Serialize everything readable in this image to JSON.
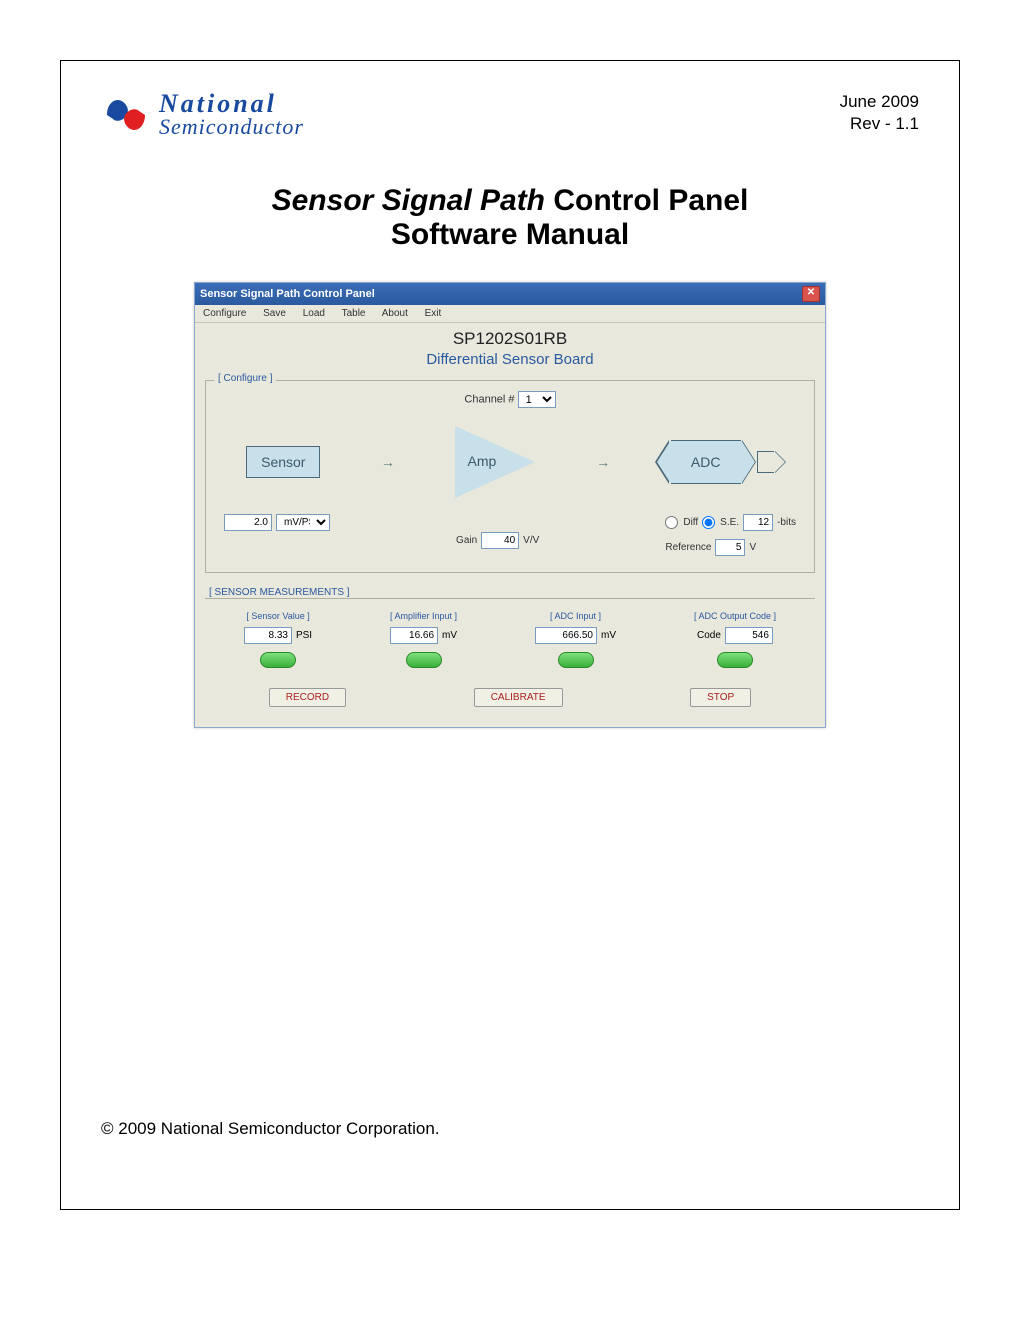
{
  "header": {
    "logo_main": "National",
    "logo_sub": "Semiconductor",
    "date": "June 2009",
    "rev": "Rev -  1.1"
  },
  "title": {
    "italic": "Sensor Signal Path",
    "bold1": " Control Panel",
    "line2": "Software Manual"
  },
  "app": {
    "title": "Sensor Signal Path Control Panel",
    "menu": [
      "Configure",
      "Save",
      "Load",
      "Table",
      "About",
      "Exit"
    ],
    "board_id": "SP1202S01RB",
    "board_desc": "Differential Sensor Board",
    "configure_label": "[ Configure ]",
    "channel_label": "Channel #",
    "channel_value": "1",
    "block_sensor": "Sensor",
    "block_amp": "Amp",
    "block_adc": "ADC",
    "sensor_value": "2.0",
    "sensor_unit": "mV/PSI",
    "gain_label": "Gain",
    "gain_value": "40",
    "gain_unit": "V/V",
    "diff_label": "Diff",
    "se_label": "S.E.",
    "bits_value": "12",
    "bits_unit": "-bits",
    "ref_label": "Reference",
    "ref_value": "5",
    "ref_unit": "V",
    "meas_title": "[ SENSOR MEASUREMENTS ]",
    "meas": {
      "c1": {
        "label": "[ Sensor Value ]",
        "value": "8.33",
        "unit": "PSI"
      },
      "c2": {
        "label": "[ Amplifier Input ]",
        "value": "16.66",
        "unit": "mV"
      },
      "c3": {
        "label": "[ ADC Input ]",
        "value": "666.50",
        "unit": "mV"
      },
      "c4": {
        "label": "[ ADC Output Code ]",
        "value": "546",
        "prefix": "Code"
      }
    },
    "buttons": {
      "record": "RECORD",
      "calibrate": "CALIBRATE",
      "stop": "STOP"
    }
  },
  "copyright": "© 2009 National Semiconductor Corporation."
}
